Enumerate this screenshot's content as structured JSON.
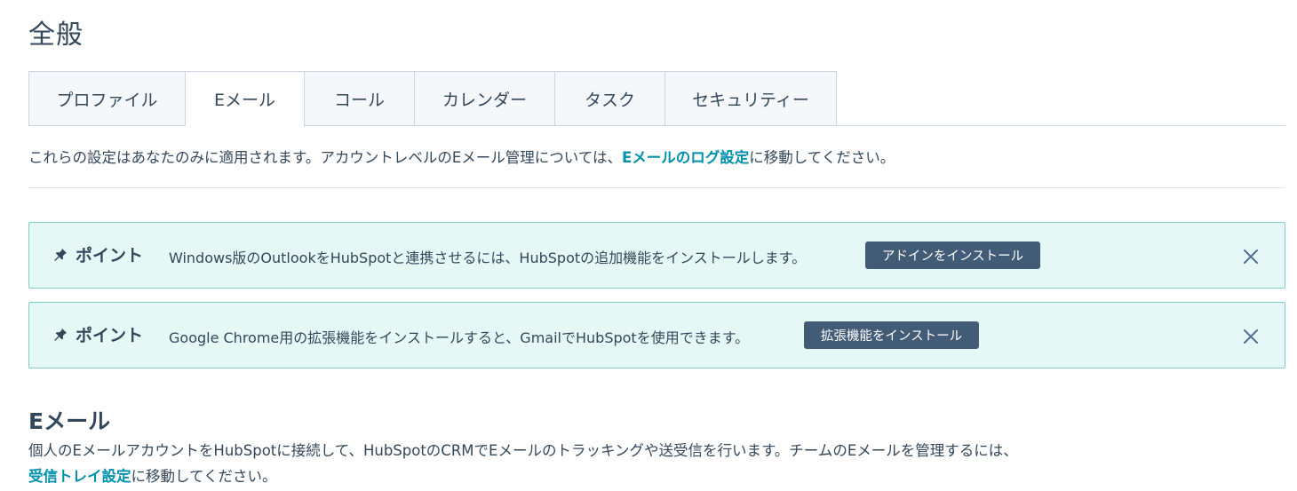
{
  "page": {
    "title": "全般"
  },
  "tabs": [
    {
      "label": "プロファイル",
      "active": false
    },
    {
      "label": "Eメール",
      "active": true
    },
    {
      "label": "コール",
      "active": false
    },
    {
      "label": "カレンダー",
      "active": false
    },
    {
      "label": "タスク",
      "active": false
    },
    {
      "label": "セキュリティー",
      "active": false
    }
  ],
  "intro": {
    "before": "これらの設定はあなたのみに適用されます。アカウントレベルのEメール管理については、",
    "link": "Eメールのログ設定",
    "after": "に移動してください。"
  },
  "tips": [
    {
      "label": "ポイント",
      "text": "Windows版のOutlookをHubSpotと連携させるには、HubSpotの追加機能をインストールします。",
      "button": "アドインをインストール"
    },
    {
      "label": "ポイント",
      "text": "Google Chrome用の拡張機能をインストールすると、GmailでHubSpotを使用できます。",
      "button": "拡張機能をインストール"
    }
  ],
  "email_section": {
    "title": "Eメール",
    "desc_before": "個人のEメールアカウントをHubSpotに接続して、HubSpotのCRMでEメールのトラッキングや送受信を行います。チームのEメールを管理するには、",
    "desc_link": "受信トレイ設定",
    "desc_after": "に移動してください。"
  },
  "icons": {
    "pin": "pin-icon",
    "close": "close-icon"
  },
  "colors": {
    "accent_link": "#0091ae",
    "tip_bg": "#e5f8f6",
    "tip_border": "#7fd1c7",
    "button_bg": "#425b76"
  }
}
